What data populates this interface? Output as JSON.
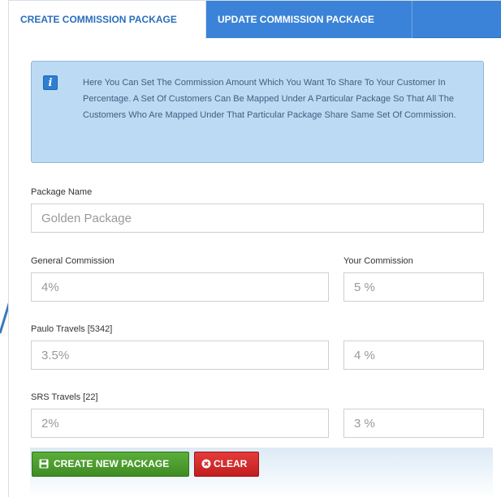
{
  "tabs": [
    {
      "label": "CREATE COMMISSION PACKAGE",
      "active": true
    },
    {
      "label": "UPDATE COMMISSION PACKAGE",
      "active": false
    }
  ],
  "info": {
    "icon": "info-icon",
    "text": "Here You Can Set The Commission Amount Which You Want To Share To Your Customer In Percentage. A Set Of Customers Can Be Mapped Under A Particular Package So That All The Customers Who Are Mapped Under That Particular Package Share Same Set Of Commission."
  },
  "form": {
    "package_name_label": "Package Name",
    "package_name_value": "Golden Package",
    "general_commission_label": "General Commission",
    "your_commission_label": "Your Commission",
    "rows": [
      {
        "label": "",
        "general": "4%",
        "yours": "5 %"
      },
      {
        "label": "Paulo Travels [5342]",
        "general": "3.5%",
        "yours": "4 %"
      },
      {
        "label": "SRS Travels [22]",
        "general": "2%",
        "yours": "3 %"
      }
    ]
  },
  "buttons": {
    "create_label": "CREATE NEW PACKAGE",
    "clear_label": "CLEAR"
  },
  "colors": {
    "tab_bar": "#3b83d8",
    "active_tab_text": "#2a6ebb",
    "info_bg": "#bcdaf3",
    "create_button": "#4a9c2d",
    "clear_button": "#d32a2a"
  }
}
